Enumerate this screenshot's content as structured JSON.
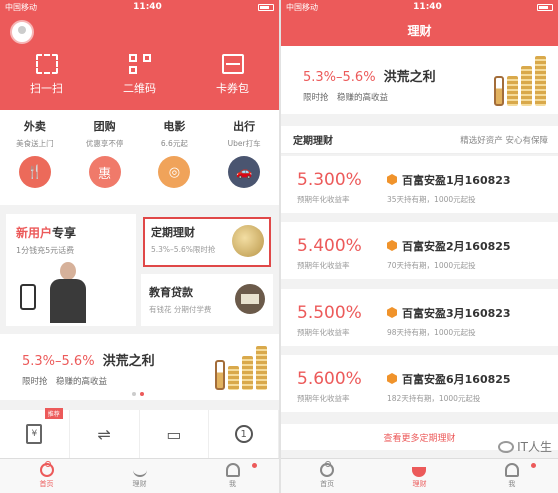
{
  "status_bar": {
    "carrier": "中国移动",
    "time": "11:40"
  },
  "left": {
    "header_actions": [
      {
        "label": "扫一扫",
        "icon": "scan-icon"
      },
      {
        "label": "二维码",
        "icon": "qr-code-icon"
      },
      {
        "label": "卡券包",
        "icon": "card-wallet-icon"
      }
    ],
    "services": [
      {
        "title": "外卖",
        "subtitle": "美食送上门",
        "color": "#ec6a5a",
        "glyph": "🍴"
      },
      {
        "title": "团购",
        "subtitle": "优惠享不停",
        "color": "#f07a6a",
        "glyph": "惠"
      },
      {
        "title": "电影",
        "subtitle": "6.6元起",
        "color": "#f0a35a",
        "glyph": "◎"
      },
      {
        "title": "出行",
        "subtitle": "Uber打车",
        "color": "#4a5570",
        "glyph": "🚗"
      }
    ],
    "new_user": {
      "title_a": "新用户",
      "title_b": "专享",
      "subtitle": "1分钱充5元话费"
    },
    "fixed_finance": {
      "title": "定期理财",
      "subtitle": "5.3%–5.6%限时抢"
    },
    "edu_loan": {
      "title": "教育贷款",
      "subtitle": "有钱花 分期付学费"
    },
    "banner": {
      "rate": "5.3%–5.6%",
      "name": "洪荒之利",
      "sub": "限时抢　稳赚的高收益"
    },
    "shortcut_ribbon": "推荐",
    "shortcuts": [
      {
        "glyph": "¥",
        "icon": "money-card-icon"
      },
      {
        "glyph": "⇌",
        "icon": "transfer-icon"
      },
      {
        "glyph": "▭",
        "icon": "card-icon"
      },
      {
        "glyph": "1",
        "icon": "number-one-icon"
      }
    ],
    "tabs": [
      "首页",
      "理财",
      "我"
    ]
  },
  "right": {
    "title": "理财",
    "banner": {
      "rate": "5.3%–5.6%",
      "name": "洪荒之利",
      "sub": "限时抢　稳赚的高收益"
    },
    "section": {
      "title": "定期理财",
      "tagline": "精选好资产 安心有保障"
    },
    "products": [
      {
        "rate": "5.300%",
        "rate_label": "预期年化收益率",
        "name": "百富安盈1月160823",
        "desc": "35天持有期，1000元起投"
      },
      {
        "rate": "5.400%",
        "rate_label": "预期年化收益率",
        "name": "百富安盈2月160825",
        "desc": "70天持有期，1000元起投"
      },
      {
        "rate": "5.500%",
        "rate_label": "预期年化收益率",
        "name": "百富安盈3月160823",
        "desc": "98天持有期，1000元起投"
      },
      {
        "rate": "5.600%",
        "rate_label": "预期年化收益率",
        "name": "百富安盈6月160825",
        "desc": "182天持有期，1000元起投"
      }
    ],
    "more": "查看更多定期理财",
    "tabs": [
      "首页",
      "理财",
      "我"
    ],
    "watermark": "IT人生"
  }
}
